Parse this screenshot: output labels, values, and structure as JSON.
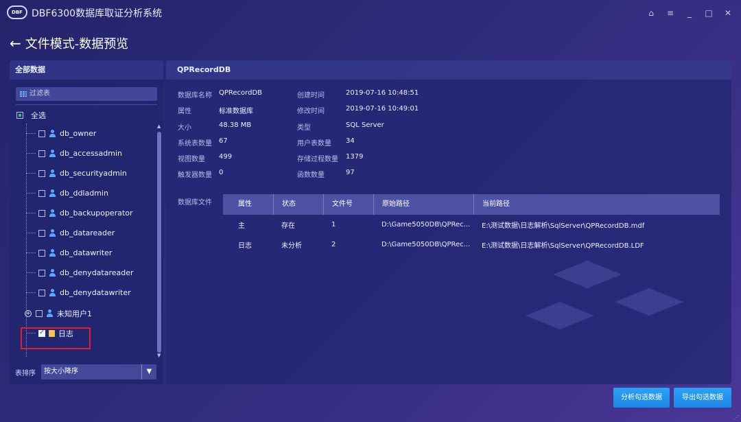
{
  "app": {
    "logo_text": "DBF",
    "title": "DBF6300数据库取证分析系统"
  },
  "window_controls": {
    "home": "⌂",
    "menu": "≡",
    "minimize": "_",
    "maximize": "□",
    "close": "✕"
  },
  "page": {
    "back_label": "←",
    "title": "文件模式-数据预览"
  },
  "left": {
    "header": "全部数据",
    "filter_placeholder": "过滤表",
    "select_all": "全选",
    "items": [
      "db_owner",
      "db_accessadmin",
      "db_securityadmin",
      "db_ddladmin",
      "db_backupoperator",
      "db_datareader",
      "db_datawriter",
      "db_denydatareader",
      "db_denydatawriter"
    ],
    "unknown_user": "未知用户1",
    "log_item": "日志",
    "sort_label": "表排序",
    "sort_value": "按大小降序"
  },
  "right": {
    "header": "QPRecordDB",
    "info": [
      {
        "k1": "数据库名称",
        "v1": "QPRecordDB",
        "k2": "创建时间",
        "v2": "2019-07-16 10:48:51"
      },
      {
        "k1": "属性",
        "v1": "标准数据库",
        "k2": "修改时间",
        "v2": "2019-07-16 10:49:01"
      },
      {
        "k1": "大小",
        "v1": "48.38 MB",
        "k2": "类型",
        "v2": "SQL Server"
      },
      {
        "k1": "系统表数量",
        "v1": "67",
        "k2": "用户表数量",
        "v2": "34"
      },
      {
        "k1": "视图数量",
        "v1": "499",
        "k2": "存储过程数量",
        "v2": "1379"
      },
      {
        "k1": "触发器数量",
        "v1": "0",
        "k2": "函数数量",
        "v2": "97"
      }
    ],
    "files_label": "数据库文件",
    "columns": [
      "属性",
      "状态",
      "文件号",
      "原始路径",
      "当前路径"
    ],
    "rows": [
      [
        "主",
        "存在",
        "1",
        "D:\\Game5050DB\\QPRec...",
        "E:\\测试数据\\日志解析\\SqlServer\\QPRecordDB.mdf"
      ],
      [
        "日志",
        "未分析",
        "2",
        "D:\\Game5050DB\\QPRec...",
        "E:\\测试数据\\日志解析\\SqlServer\\QPRecordDB.LDF"
      ]
    ]
  },
  "buttons": {
    "analyze": "分析勾选数据",
    "export": "导出勾选数据"
  },
  "colors": {
    "accent": "#1e86e6",
    "highlight": "#e01e2e"
  }
}
